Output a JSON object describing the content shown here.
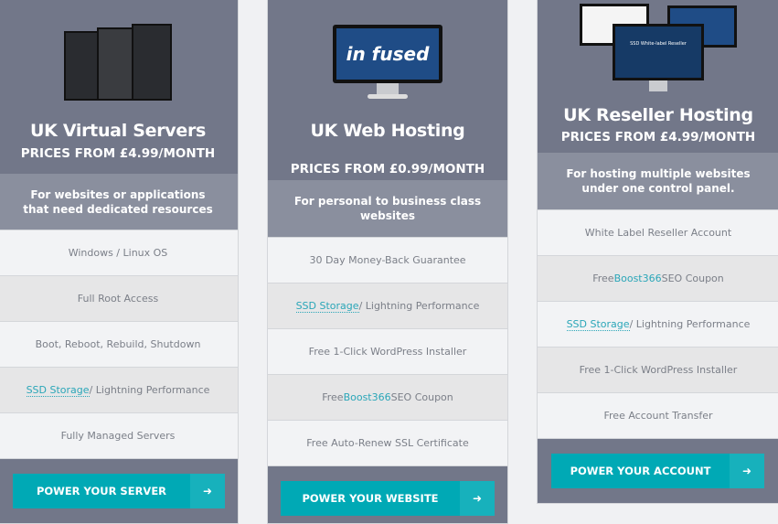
{
  "plans": [
    {
      "title": "UK Virtual Servers",
      "price": "PRICES FROM £4.99/MONTH",
      "description": "For websites or applications that need dedicated resources",
      "features": [
        {
          "text": "Windows / Linux OS"
        },
        {
          "text": "Full Root Access"
        },
        {
          "text": "Boot, Reboot, Rebuild, Shutdown"
        },
        {
          "link": "SSD Storage",
          "text": " / Lightning Performance"
        },
        {
          "text": "Fully Managed Servers"
        }
      ],
      "button": "POWER YOUR SERVER"
    },
    {
      "title": "UK Web Hosting",
      "price": "PRICES FROM £0.99/MONTH",
      "description": "For personal to business class websites",
      "logo": "in fused",
      "features": [
        {
          "text": "30 Day Money-Back Guarantee"
        },
        {
          "link": "SSD Storage",
          "text": " / Lightning Performance"
        },
        {
          "text": "Free 1-Click WordPress Installer"
        },
        {
          "pre": "Free ",
          "brand": "Boost366",
          "text": " SEO Coupon"
        },
        {
          "text": "Free Auto-Renew SSL Certificate"
        }
      ],
      "button": "POWER YOUR WEBSITE"
    },
    {
      "title": "UK Reseller Hosting",
      "price": "PRICES FROM £4.99/MONTH",
      "description": "For hosting multiple websites under one control panel.",
      "screen_text": "SSD White-label Reseller",
      "features": [
        {
          "text": "White Label Reseller Account"
        },
        {
          "pre": "Free ",
          "brand": "Boost366",
          "text": " SEO Coupon"
        },
        {
          "link": "SSD Storage",
          "text": " / Lightning Performance"
        },
        {
          "text": "Free 1-Click WordPress Installer"
        },
        {
          "text": "Free Account Transfer"
        }
      ],
      "button": "POWER YOUR ACCOUNT"
    }
  ],
  "icons": {
    "button": "arrow-circle-right-icon"
  },
  "colors": {
    "header": "#727789",
    "subheader": "#8a8f9e",
    "button": "#00a9b5",
    "link": "#2aa6b8"
  }
}
